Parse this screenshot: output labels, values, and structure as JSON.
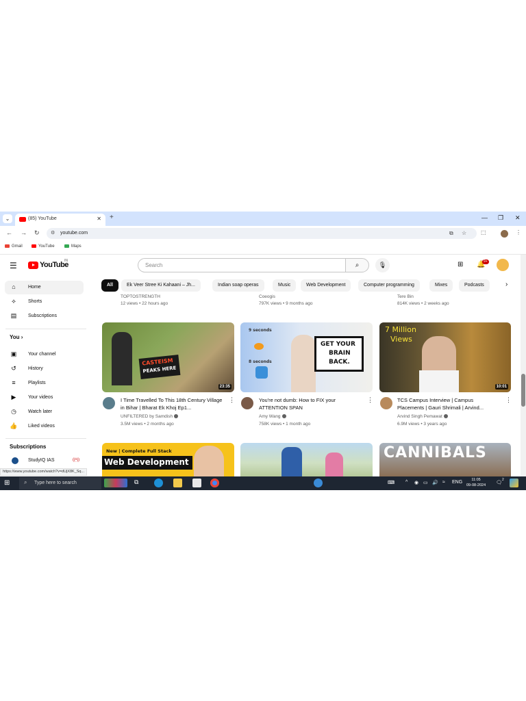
{
  "browser": {
    "tab_title": "(85) YouTube",
    "url": "youtube.com",
    "bookmarks": [
      "Gmail",
      "YouTube",
      "Maps"
    ],
    "status_url": "https://www.youtube.com/watch?v=dUjX8K_Sq..."
  },
  "youtube": {
    "logo_text": "YouTube",
    "region": "IN",
    "search_placeholder": "Search",
    "notification_count": "9+"
  },
  "sidebar": {
    "items": [
      {
        "label": "Home",
        "icon": "home-icon"
      },
      {
        "label": "Shorts",
        "icon": "shorts-icon"
      },
      {
        "label": "Subscriptions",
        "icon": "subscriptions-icon"
      }
    ],
    "you_heading": "You",
    "you_items": [
      {
        "label": "Your channel",
        "icon": "channel-icon"
      },
      {
        "label": "History",
        "icon": "history-icon"
      },
      {
        "label": "Playlists",
        "icon": "playlists-icon"
      },
      {
        "label": "Your videos",
        "icon": "your-videos-icon"
      },
      {
        "label": "Watch later",
        "icon": "watch-later-icon"
      },
      {
        "label": "Liked videos",
        "icon": "like-icon"
      }
    ],
    "subscriptions_heading": "Subscriptions",
    "subscriptions": [
      {
        "label": "StudyIQ IAS"
      }
    ]
  },
  "chips": [
    "All",
    "Ek Veer Stree Ki Kahaani – Jh...",
    "Indian soap operas",
    "Music",
    "Web Development",
    "Computer programming",
    "Mixes",
    "Podcasts"
  ],
  "previous_row": [
    {
      "channel": "TOPTOSTRENGTH",
      "stats": "12 views • 22 hours ago"
    },
    {
      "channel": "Coeogis",
      "stats": "797K views • 9 months ago"
    },
    {
      "channel": "Tere Bin",
      "stats": "814K views • 2 weeks ago"
    }
  ],
  "videos": [
    {
      "title": "I Time Travelled To This 18th Century Village in Bihar | Bharat Ek Khoj Ep1...",
      "channel": "UNFILTERED by Samdish",
      "stats": "3.5M views • 2 months ago",
      "duration": "23:35",
      "thumb_text": [
        "CASTEISM",
        "PEAKS HERE"
      ]
    },
    {
      "title": "You're not dumb: How to FIX your ATTENTION SPAN",
      "channel": "Amy Wang",
      "stats": "758K views • 1 month ago",
      "duration": "",
      "thumb_text": [
        "GET YOUR",
        "BRAIN",
        "BACK.",
        "9 seconds",
        "8 seconds"
      ]
    },
    {
      "title": "TCS Campus Interview | Campus Placements | Gauri Shrimali | Arvind...",
      "channel": "Arvind Singh Pemawat",
      "stats": "6.9M views • 3 years ago",
      "duration": "10:01",
      "thumb_text": [
        "7 Million",
        "Views"
      ]
    }
  ],
  "next_row_thumbs": [
    {
      "thumb_text": [
        "New | Complete Full Stack",
        "Web Development"
      ]
    },
    {
      "thumb_text": []
    },
    {
      "thumb_text": [
        "CANNIBALS"
      ]
    }
  ],
  "taskbar": {
    "search_placeholder": "Type here to search",
    "language": "ENG",
    "time": "11:05",
    "date": "09-08-2024",
    "notif_count": "2"
  }
}
